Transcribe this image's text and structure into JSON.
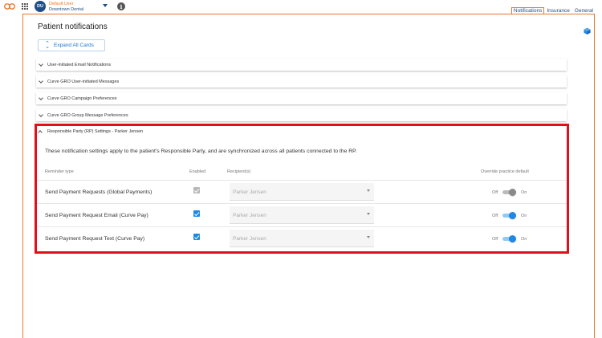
{
  "user": {
    "initials": "DU",
    "name": "Default User",
    "office": "Downtown Dental"
  },
  "tabs": [
    {
      "label": "Notifications",
      "active": true
    },
    {
      "label": "Insurance",
      "active": false
    },
    {
      "label": "General",
      "active": false
    }
  ],
  "page": {
    "title": "Patient notifications",
    "expand_label": "Expand All Cards"
  },
  "sections": [
    {
      "label": "User-initiated Email Notifications",
      "expanded": false
    },
    {
      "label": "Curve GRO User-initiated Messages",
      "expanded": false
    },
    {
      "label": "Curve GRO Campaign Preferences",
      "expanded": false
    },
    {
      "label": "Curve GRO Group Message Preferences",
      "expanded": false
    }
  ],
  "rp": {
    "header": "Responsible Party (RP) Settings - Parker Jensen",
    "description": "These notification settings apply to the patient's Responsible Party, and are synchronized across all patients connected to the RP.",
    "columns": {
      "type": "Reminder type",
      "enabled": "Enabled",
      "recipients": "Recipient(s)",
      "override": "Override practice default"
    },
    "rows": [
      {
        "label": "Send Payment Requests (Global Payments)",
        "enabled": true,
        "enabled_disabled": true,
        "recipient": "Parker Jensen",
        "off": "Off",
        "on": "On",
        "override": false
      },
      {
        "label": "Send Payment Request Email (Curve Pay)",
        "enabled": true,
        "enabled_disabled": false,
        "recipient": "Parker Jensen",
        "off": "Off",
        "on": "On",
        "override": true
      },
      {
        "label": "Send Payment Request Text (Curve Pay)",
        "enabled": true,
        "enabled_disabled": false,
        "recipient": "Parker Jensen",
        "off": "Off",
        "on": "On",
        "override": true
      }
    ]
  },
  "colors": {
    "accent": "#e8762d",
    "brand_blue": "#1d4e89",
    "highlight_red": "#e0101a",
    "toggle_on": "#1e88e5"
  },
  "icons": {
    "logo": "curve-logo-icon",
    "apps": "grid-icon",
    "info": "info-icon",
    "cube": "cube-icon"
  }
}
